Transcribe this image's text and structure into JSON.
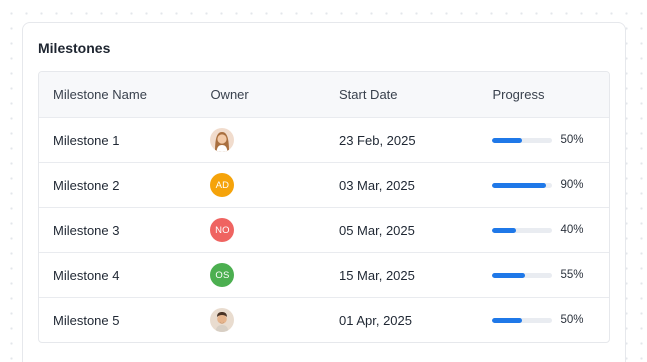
{
  "card": {
    "title": "Milestones"
  },
  "table": {
    "headers": [
      "Milestone Name",
      "Owner",
      "Start Date",
      "Progress"
    ],
    "rows": [
      {
        "name": "Milestone 1",
        "owner": {
          "type": "photo",
          "icon": "person-photo-woman",
          "initials": ""
        },
        "start_date": "23 Feb, 2025",
        "progress": 0.5,
        "progress_label": "50%"
      },
      {
        "name": "Milestone 2",
        "owner": {
          "type": "initials",
          "initials": "AD",
          "color": "#f5a30a"
        },
        "start_date": "03 Mar, 2025",
        "progress": 0.9,
        "progress_label": "90%"
      },
      {
        "name": "Milestone 3",
        "owner": {
          "type": "initials",
          "initials": "NO",
          "color": "#ef6461"
        },
        "start_date": "05 Mar, 2025",
        "progress": 0.4,
        "progress_label": "40%"
      },
      {
        "name": "Milestone 4",
        "owner": {
          "type": "initials",
          "initials": "OS",
          "color": "#4caf50"
        },
        "start_date": "15 Mar, 2025",
        "progress": 0.55,
        "progress_label": "55%"
      },
      {
        "name": "Milestone 5",
        "owner": {
          "type": "photo",
          "icon": "person-photo-man",
          "initials": ""
        },
        "start_date": "01 Apr, 2025",
        "progress": 0.5,
        "progress_label": "50%"
      }
    ]
  },
  "colors": {
    "progress_fill": "#1f78e8",
    "progress_track": "#e9ecf1"
  }
}
